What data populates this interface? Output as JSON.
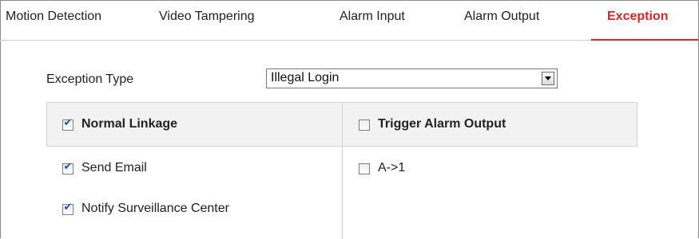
{
  "tabs": [
    {
      "label": "Motion Detection"
    },
    {
      "label": "Video Tampering"
    },
    {
      "label": "Alarm Input"
    },
    {
      "label": "Alarm Output"
    },
    {
      "label": "Exception"
    }
  ],
  "active_tab": "Exception",
  "accent_color": "#d9262b",
  "check_color": "#1a4cc4",
  "exception_type": {
    "label": "Exception Type",
    "selected": "Illegal Login"
  },
  "normal_linkage": {
    "label": "Normal Linkage",
    "checked": true,
    "items": [
      {
        "label": "Send Email",
        "checked": true
      },
      {
        "label": "Notify Surveillance Center",
        "checked": true
      }
    ]
  },
  "trigger_alarm_output": {
    "label": "Trigger Alarm Output",
    "checked": false,
    "items": [
      {
        "label": "A->1",
        "checked": false
      }
    ]
  }
}
